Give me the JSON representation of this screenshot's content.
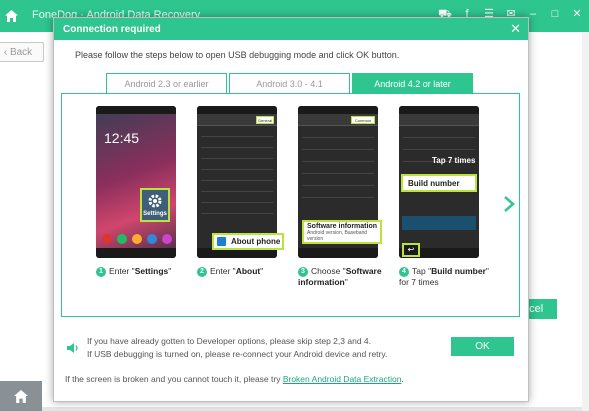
{
  "app": {
    "title": "FoneDog · Android Data Recovery",
    "back_label": "Back",
    "cancel_fragment": "ncel",
    "colors": {
      "accent": "#2ec58f",
      "highlight": "#b9e33d"
    }
  },
  "dialog": {
    "title": "Connection required",
    "close_label": "✕",
    "instruction": "Please follow the steps below to open USB debugging mode and click OK button.",
    "tabs": [
      {
        "label": "Android 2.3 or earlier",
        "active": false
      },
      {
        "label": "Android 3.0 - 4.1",
        "active": false
      },
      {
        "label": "Android 4.2 or later",
        "active": true
      }
    ],
    "steps": [
      {
        "num": "1",
        "pre": "Enter \"",
        "bold": "Settings",
        "post": "\"",
        "callout": "Settings"
      },
      {
        "num": "2",
        "pre": "Enter \"",
        "bold": "About",
        "post": "\"",
        "callout": "About phone"
      },
      {
        "num": "3",
        "pre": "Choose \"",
        "bold": "Software information",
        "post": "\"",
        "callout": "Software information",
        "callout_sub": "Android version, Baseband version"
      },
      {
        "num": "4",
        "pre": "Tap \"",
        "bold": "Build number",
        "post": "\" for 7 times",
        "callout": "Build number",
        "callout_top": "Tap 7 times"
      }
    ],
    "notes": [
      "If you have already gotten to Developer options, please skip step 2,3 and 4.",
      "If USB debugging is turned on, please re-connect your Android device and retry."
    ],
    "ok_label": "OK",
    "broken_text": "If the screen is broken and you cannot touch it, please try ",
    "broken_link": "Broken Android Data Extraction",
    "broken_end": "."
  }
}
